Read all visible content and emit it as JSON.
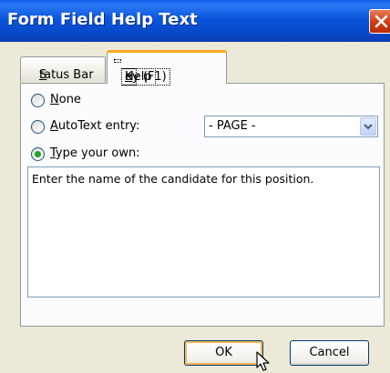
{
  "window": {
    "title": "Form Field Help Text"
  },
  "tabs": [
    {
      "label_pre": "",
      "accel": "S",
      "label_post": "tatus Bar",
      "selected": false
    },
    {
      "label_pre": "Help ",
      "accel": "K",
      "label_post": "ey (F1)",
      "selected": true
    }
  ],
  "help_key": {
    "options": [
      {
        "accel": "N",
        "rest": "one",
        "checked": false
      },
      {
        "accel": "A",
        "rest": "utoText entry:",
        "checked": false
      },
      {
        "accel": "T",
        "rest": "ype your own:",
        "checked": true
      }
    ],
    "autotext_value": "- PAGE -",
    "help_text": "Enter the name of the candidate for this position."
  },
  "buttons": {
    "ok": "OK",
    "cancel": "Cancel"
  },
  "icons": {
    "close": "close-icon",
    "dropdown": "chevron-down-icon",
    "cursor": "mouse-pointer-icon"
  },
  "colors": {
    "titlebar": "#0a55dc",
    "close_button": "#cf3b12",
    "selected_tab_highlight": "#f7a822",
    "radio_checked": "#21a121",
    "dialog_background": "#ece9d8"
  }
}
